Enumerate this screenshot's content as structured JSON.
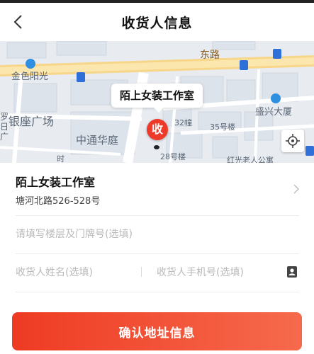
{
  "header": {
    "title": "收货人信息"
  },
  "map": {
    "bubble_text": "陌上女装工作室",
    "pin_text": "收",
    "labels": {
      "road_top": "东路",
      "jinse": "金色阳光",
      "yinzuo": "银座广场",
      "zhongtong": "中通华庭",
      "shengxing": "盛兴大厦",
      "b32": "32幢",
      "b35": "35号楼",
      "b28": "28号楼",
      "hong": "红光老人公寓",
      "left_edge": "罗日广",
      "shi": "时"
    }
  },
  "address": {
    "name": "陌上女装工作室",
    "street": "塘河北路526-528号"
  },
  "form": {
    "floor_placeholder": "请填写楼层及门牌号(选填)",
    "name_placeholder": "收货人姓名(选填)",
    "phone_placeholder": "收货人手机号(选填)"
  },
  "confirm_label": "确认地址信息"
}
